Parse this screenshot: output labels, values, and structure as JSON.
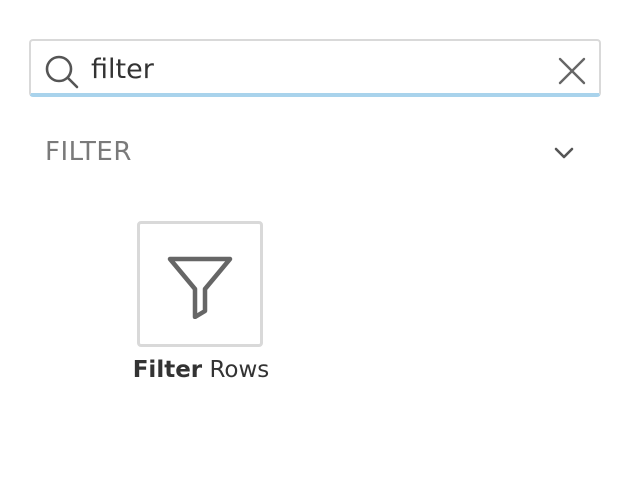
{
  "search": {
    "value": "filter",
    "placeholder": "",
    "focus_color": "#a9d3ec"
  },
  "section": {
    "title": "FILTER",
    "expanded": true
  },
  "results": [
    {
      "icon": "filter-funnel-icon",
      "label_match": "Filter",
      "label_rest": " Rows"
    }
  ]
}
